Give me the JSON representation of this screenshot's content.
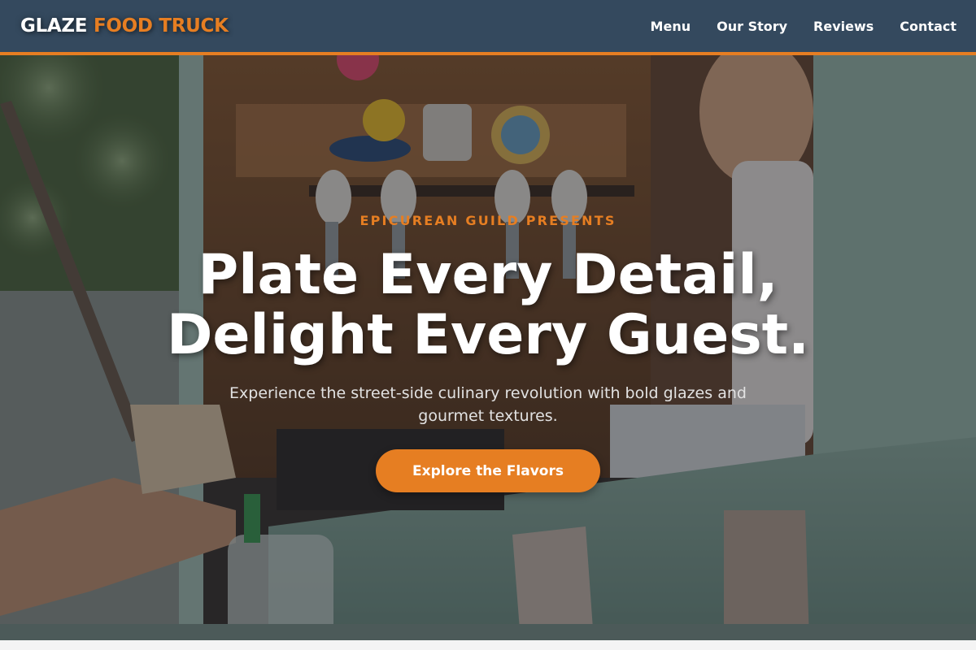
{
  "brand": {
    "word1": "GLAZE",
    "word2": "FOOD TRUCK",
    "accent_color": "#e67e22",
    "nav_color": "#34495e"
  },
  "nav": {
    "links": [
      {
        "label": "Menu"
      },
      {
        "label": "Our Story"
      },
      {
        "label": "Reviews"
      },
      {
        "label": "Contact"
      }
    ]
  },
  "hero": {
    "eyebrow": "EPICUREAN GUILD PRESENTS",
    "headline_line1": "Plate Every Detail,",
    "headline_line2": "Delight Every Guest.",
    "subtext": "Experience the street-side culinary revolution with bold glazes and gourmet textures.",
    "cta_label": "Explore the Flavors",
    "background": "photo-food-truck-counter"
  }
}
